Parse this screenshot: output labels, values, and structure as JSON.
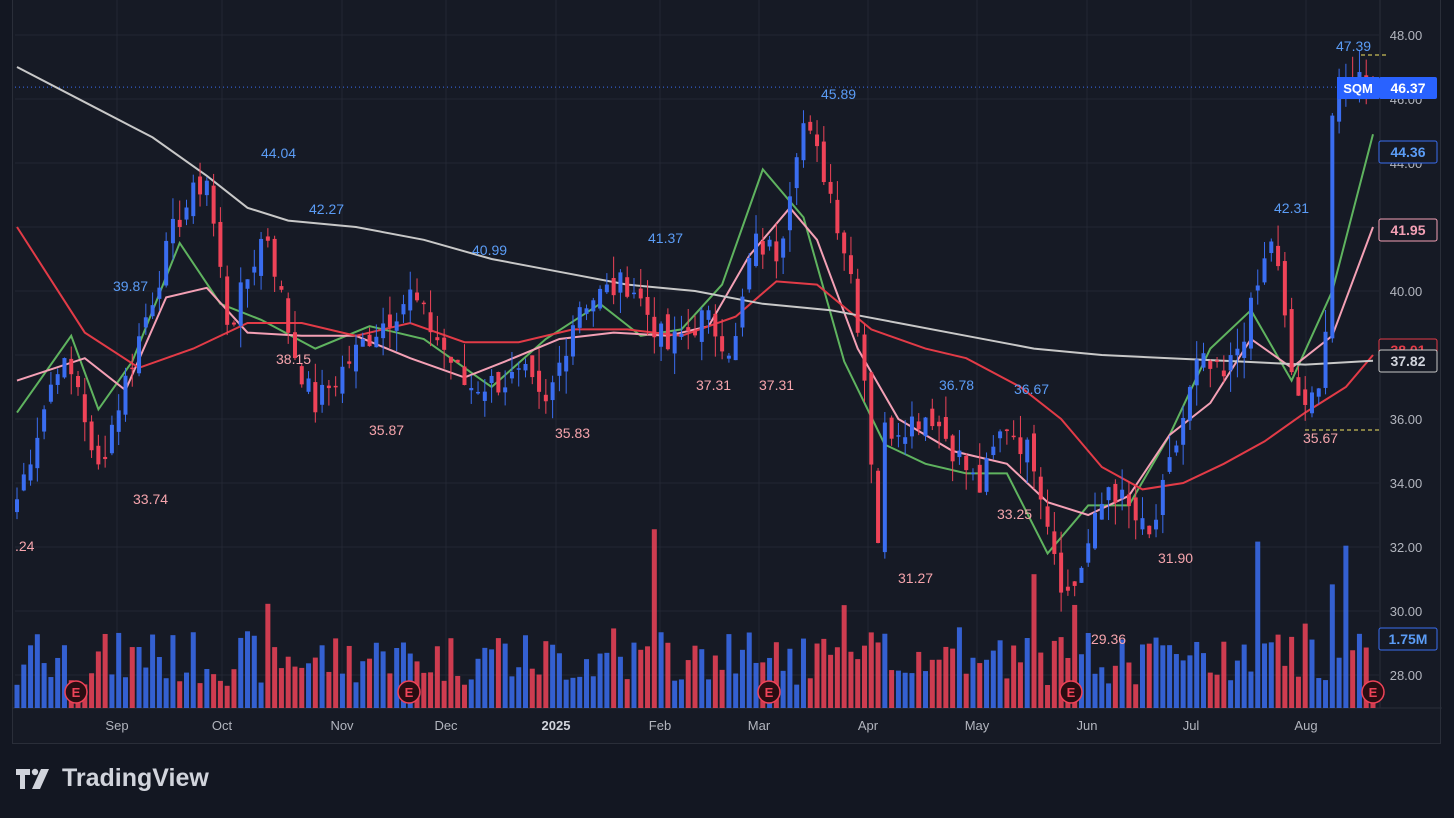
{
  "symbol": "SQM",
  "brand": {
    "name": "TradingView"
  },
  "colors": {
    "background": "#161a25",
    "grid": "#232734",
    "up": "#3a6df0",
    "down": "#ef4358",
    "ma_fast": "#5fb35f",
    "ma_mid": "#f4a0b5",
    "ma_slow": "#e23b47",
    "ma_long": "#c8c8c8",
    "axis_text": "#b2b5be"
  },
  "price_axis": {
    "ticks": [
      "48.00",
      "46.00",
      "44.00",
      "42.00",
      "40.00",
      "38.00",
      "36.00",
      "34.00",
      "32.00",
      "30.00",
      "28.00"
    ],
    "labels": {
      "symbol_tag": "SQM",
      "last_price": "46.37",
      "ma_fast_value": "44.36",
      "ma_mid_value": "41.95",
      "ma_long_value": "37.82",
      "ma_slow_hidden": "38.01",
      "volume_value": "1.75M"
    }
  },
  "time_axis": {
    "ticks": [
      "Sep",
      "Oct",
      "Nov",
      "Dec",
      "2025",
      "Feb",
      "Mar",
      "Apr",
      "May",
      "Jun",
      "Jul",
      "Aug"
    ]
  },
  "annotations": [
    {
      "text": "39.87",
      "kind": "high"
    },
    {
      "text": "44.04",
      "kind": "high"
    },
    {
      "text": "42.27",
      "kind": "high"
    },
    {
      "text": "40.99",
      "kind": "high"
    },
    {
      "text": "41.37",
      "kind": "high"
    },
    {
      "text": "45.89",
      "kind": "high"
    },
    {
      "text": "36.78",
      "kind": "high"
    },
    {
      "text": "36.67",
      "kind": "high"
    },
    {
      "text": "42.31",
      "kind": "high"
    },
    {
      "text": "47.39",
      "kind": "high"
    },
    {
      "text": ".24",
      "kind": "low"
    },
    {
      "text": "33.74",
      "kind": "low"
    },
    {
      "text": "38.15",
      "kind": "low"
    },
    {
      "text": "35.87",
      "kind": "low"
    },
    {
      "text": "35.83",
      "kind": "low"
    },
    {
      "text": "37.31",
      "kind": "low"
    },
    {
      "text": "37.31",
      "kind": "low"
    },
    {
      "text": "31.27",
      "kind": "low"
    },
    {
      "text": "33.25",
      "kind": "low"
    },
    {
      "text": "29.36",
      "kind": "low"
    },
    {
      "text": "31.90",
      "kind": "low"
    },
    {
      "text": "35.67",
      "kind": "low"
    }
  ],
  "earnings_marker": "E",
  "chart_data": {
    "type": "candlestick",
    "symbol": "SQM",
    "ylim": [
      27,
      49
    ],
    "x_labels": [
      "Sep",
      "Oct",
      "Nov",
      "Dec",
      "2025",
      "Feb",
      "Mar",
      "Apr",
      "May",
      "Jun",
      "Jul",
      "Aug"
    ],
    "anchors": [
      {
        "date": "2024-08-19",
        "close": 33.5
      },
      {
        "date": "2024-08-30",
        "close": 37.8
      },
      {
        "date": "2024-09-05",
        "close": 37.0
      },
      {
        "date": "2024-09-09",
        "close": 34.1
      },
      {
        "date": "2024-09-18",
        "close": 37.5
      },
      {
        "date": "2024-10-01",
        "close": 42.2
      },
      {
        "date": "2024-10-09",
        "close": 43.6
      },
      {
        "date": "2024-10-15",
        "close": 38.8
      },
      {
        "date": "2024-10-25",
        "close": 42.0
      },
      {
        "date": "2024-11-01",
        "close": 38.3
      },
      {
        "date": "2024-11-07",
        "close": 36.4
      },
      {
        "date": "2024-11-21",
        "close": 38.5
      },
      {
        "date": "2024-12-03",
        "close": 39.9
      },
      {
        "date": "2024-12-18",
        "close": 37.0
      },
      {
        "date": "2025-01-03",
        "close": 37.3
      },
      {
        "date": "2025-01-08",
        "close": 36.2
      },
      {
        "date": "2025-01-17",
        "close": 39.6
      },
      {
        "date": "2025-01-31",
        "close": 40.3
      },
      {
        "date": "2025-02-10",
        "close": 38.2
      },
      {
        "date": "2025-02-20",
        "close": 39.2
      },
      {
        "date": "2025-02-28",
        "close": 38.1
      },
      {
        "date": "2025-03-05",
        "close": 41.5
      },
      {
        "date": "2025-03-12",
        "close": 41.2
      },
      {
        "date": "2025-03-18",
        "close": 45.4
      },
      {
        "date": "2025-03-25",
        "close": 43.5
      },
      {
        "date": "2025-04-01",
        "close": 40.3
      },
      {
        "date": "2025-04-04",
        "close": 37.5
      },
      {
        "date": "2025-04-08",
        "close": 32.0
      },
      {
        "date": "2025-04-09",
        "close": 35.6
      },
      {
        "date": "2025-04-22",
        "close": 36.2
      },
      {
        "date": "2025-05-05",
        "close": 33.8
      },
      {
        "date": "2025-05-12",
        "close": 35.9
      },
      {
        "date": "2025-05-20",
        "close": 34.7
      },
      {
        "date": "2025-05-28",
        "close": 30.5
      },
      {
        "date": "2025-05-30",
        "close": 30.6
      },
      {
        "date": "2025-06-09",
        "close": 34.0
      },
      {
        "date": "2025-06-20",
        "close": 32.2
      },
      {
        "date": "2025-07-03",
        "close": 37.8
      },
      {
        "date": "2025-07-10",
        "close": 37.2
      },
      {
        "date": "2025-07-17",
        "close": 39.3
      },
      {
        "date": "2025-07-23",
        "close": 41.8
      },
      {
        "date": "2025-07-28",
        "close": 37.5
      },
      {
        "date": "2025-08-01",
        "close": 36.0
      },
      {
        "date": "2025-08-06",
        "close": 38.0
      },
      {
        "date": "2025-08-08",
        "close": 45.5
      },
      {
        "date": "2025-08-14",
        "close": 46.8
      },
      {
        "date": "2025-08-19",
        "close": 46.37
      }
    ],
    "moving_averages": [
      {
        "name": "MA fast",
        "color": "#5fb35f",
        "points": [
          [
            0,
            36.2
          ],
          [
            8,
            38.6
          ],
          [
            12,
            36.3
          ],
          [
            17,
            37.8
          ],
          [
            24,
            41.5
          ],
          [
            30,
            39.6
          ],
          [
            36,
            39.1
          ],
          [
            44,
            38.2
          ],
          [
            52,
            38.9
          ],
          [
            60,
            38.5
          ],
          [
            70,
            37.0
          ],
          [
            78,
            38.5
          ],
          [
            86,
            39.6
          ],
          [
            92,
            38.6
          ],
          [
            98,
            38.8
          ],
          [
            104,
            40.2
          ],
          [
            110,
            43.8
          ],
          [
            116,
            42.3
          ],
          [
            122,
            37.8
          ],
          [
            128,
            35.2
          ],
          [
            134,
            34.6
          ],
          [
            140,
            34.3
          ],
          [
            146,
            34.3
          ],
          [
            152,
            31.8
          ],
          [
            158,
            33.3
          ],
          [
            164,
            33.3
          ],
          [
            170,
            35.5
          ],
          [
            176,
            38.2
          ],
          [
            182,
            39.4
          ],
          [
            188,
            37.2
          ],
          [
            194,
            40.0
          ],
          [
            200,
            44.9
          ]
        ]
      },
      {
        "name": "MA mid",
        "color": "#f4a0b5",
        "points": [
          [
            0,
            37.2
          ],
          [
            10,
            37.9
          ],
          [
            16,
            36.9
          ],
          [
            22,
            39.8
          ],
          [
            28,
            40.1
          ],
          [
            34,
            38.7
          ],
          [
            42,
            38.6
          ],
          [
            50,
            38.6
          ],
          [
            58,
            37.9
          ],
          [
            66,
            37.3
          ],
          [
            72,
            37.8
          ],
          [
            80,
            38.5
          ],
          [
            88,
            38.7
          ],
          [
            96,
            38.6
          ],
          [
            102,
            38.9
          ],
          [
            108,
            41.1
          ],
          [
            114,
            42.6
          ],
          [
            118,
            41.6
          ],
          [
            124,
            38.2
          ],
          [
            130,
            36.0
          ],
          [
            138,
            35.0
          ],
          [
            146,
            34.6
          ],
          [
            152,
            33.4
          ],
          [
            158,
            33.0
          ],
          [
            164,
            33.6
          ],
          [
            170,
            35.5
          ],
          [
            176,
            36.5
          ],
          [
            182,
            38.5
          ],
          [
            188,
            37.6
          ],
          [
            194,
            38.6
          ],
          [
            200,
            42.0
          ]
        ]
      },
      {
        "name": "MA slow",
        "color": "#e23b47",
        "points": [
          [
            0,
            42.0
          ],
          [
            10,
            38.7
          ],
          [
            18,
            37.6
          ],
          [
            26,
            38.2
          ],
          [
            34,
            39.0
          ],
          [
            42,
            39.0
          ],
          [
            50,
            38.6
          ],
          [
            58,
            39.0
          ],
          [
            66,
            38.4
          ],
          [
            74,
            38.4
          ],
          [
            82,
            38.8
          ],
          [
            90,
            38.8
          ],
          [
            98,
            38.6
          ],
          [
            106,
            39.2
          ],
          [
            112,
            40.3
          ],
          [
            118,
            40.2
          ],
          [
            126,
            38.8
          ],
          [
            134,
            38.2
          ],
          [
            140,
            37.9
          ],
          [
            148,
            37.0
          ],
          [
            154,
            36.0
          ],
          [
            160,
            34.5
          ],
          [
            166,
            33.8
          ],
          [
            172,
            34.0
          ],
          [
            178,
            34.6
          ],
          [
            184,
            35.3
          ],
          [
            190,
            36.2
          ],
          [
            196,
            37.0
          ],
          [
            200,
            38.0
          ]
        ]
      },
      {
        "name": "MA long",
        "color": "#c8c8c8",
        "points": [
          [
            0,
            47.0
          ],
          [
            10,
            45.9
          ],
          [
            20,
            44.8
          ],
          [
            28,
            43.6
          ],
          [
            34,
            42.6
          ],
          [
            40,
            42.2
          ],
          [
            50,
            42.0
          ],
          [
            60,
            41.6
          ],
          [
            70,
            41.0
          ],
          [
            80,
            40.6
          ],
          [
            90,
            40.2
          ],
          [
            100,
            40.0
          ],
          [
            110,
            39.6
          ],
          [
            120,
            39.4
          ],
          [
            130,
            39.0
          ],
          [
            140,
            38.6
          ],
          [
            150,
            38.2
          ],
          [
            160,
            38.0
          ],
          [
            170,
            37.9
          ],
          [
            180,
            37.8
          ],
          [
            190,
            37.7
          ],
          [
            200,
            37.82
          ]
        ]
      }
    ]
  }
}
